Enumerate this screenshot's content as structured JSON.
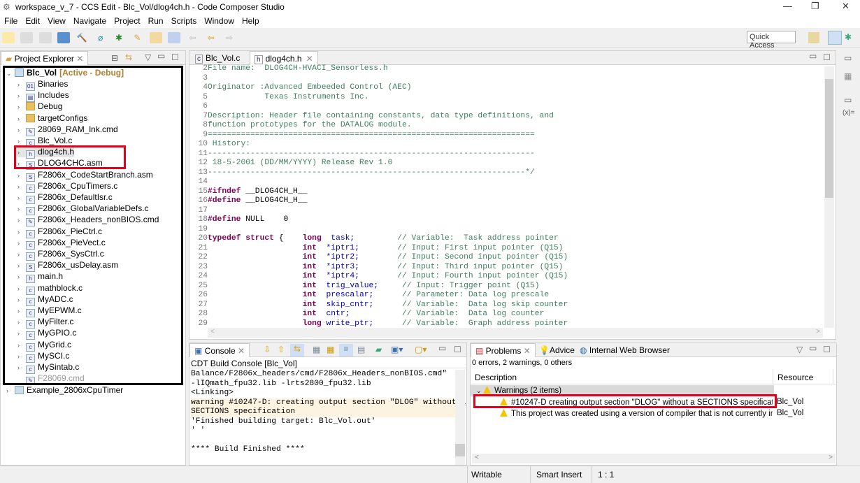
{
  "window": {
    "title": "workspace_v_7 - CCS Edit - Blc_Vol/dlog4ch.h - Code Composer Studio",
    "min": "—",
    "max": "❐",
    "close": "✕"
  },
  "menu": [
    "File",
    "Edit",
    "View",
    "Navigate",
    "Project",
    "Run",
    "Scripts",
    "Window",
    "Help"
  ],
  "toolbar": {
    "quick_access": "Quick Access"
  },
  "explorer": {
    "tab": "Project Explorer",
    "project": "Blc_Vol",
    "project_state": "[Active - Debug]",
    "items": [
      {
        "label": "Binaries",
        "icon": "binaries-icon"
      },
      {
        "label": "Includes",
        "icon": "includes-icon"
      },
      {
        "label": "Debug",
        "icon": "folder-icon"
      },
      {
        "label": "targetConfigs",
        "icon": "folder-icon"
      },
      {
        "label": "28069_RAM_lnk.cmd",
        "icon": "cmd-file-icon"
      },
      {
        "label": "Blc_Vol.c",
        "icon": "c-file-icon"
      },
      {
        "label": "dlog4ch.h",
        "icon": "h-file-icon"
      },
      {
        "label": "DLOG4CHC.asm",
        "icon": "asm-file-icon"
      },
      {
        "label": "F2806x_CodeStartBranch.asm",
        "icon": "asm-file-icon"
      },
      {
        "label": "F2806x_CpuTimers.c",
        "icon": "c-file-icon"
      },
      {
        "label": "F2806x_DefaultIsr.c",
        "icon": "c-file-icon"
      },
      {
        "label": "F2806x_GlobalVariableDefs.c",
        "icon": "c-file-icon"
      },
      {
        "label": "F2806x_Headers_nonBIOS.cmd",
        "icon": "cmd-file-icon"
      },
      {
        "label": "F2806x_PieCtrl.c",
        "icon": "c-file-icon"
      },
      {
        "label": "F2806x_PieVect.c",
        "icon": "c-file-icon"
      },
      {
        "label": "F2806x_SysCtrl.c",
        "icon": "c-file-icon"
      },
      {
        "label": "F2806x_usDelay.asm",
        "icon": "asm-file-icon"
      },
      {
        "label": "main.h",
        "icon": "h-file-icon"
      },
      {
        "label": "mathblock.c",
        "icon": "c-file-icon"
      },
      {
        "label": "MyADC.c",
        "icon": "c-file-icon"
      },
      {
        "label": "MyEPWM.c",
        "icon": "c-file-icon"
      },
      {
        "label": "MyFilter.c",
        "icon": "c-file-icon"
      },
      {
        "label": "MyGPIO.c",
        "icon": "c-file-icon"
      },
      {
        "label": "MyGrid.c",
        "icon": "c-file-icon"
      },
      {
        "label": "MySCI.c",
        "icon": "c-file-icon"
      },
      {
        "label": "MySintab.c",
        "icon": "c-file-icon"
      },
      {
        "label": "F28069.cmd",
        "icon": "cmd-file-icon"
      }
    ],
    "other_project": "Example_2806xCpuTimer"
  },
  "editor": {
    "tabs": [
      {
        "label": "Blc_Vol.c",
        "active": false
      },
      {
        "label": "dlog4ch.h",
        "active": true
      }
    ],
    "lines": [
      {
        "n": "2",
        "segs": [
          [
            "cm",
            "File name:  DLOG4CH-HVACI_Sensorless.h"
          ]
        ]
      },
      {
        "n": "3",
        "segs": []
      },
      {
        "n": "4",
        "segs": [
          [
            "cm",
            "Originator :Advanced Embeeded Control (AEC)"
          ]
        ]
      },
      {
        "n": "5",
        "segs": [
          [
            "cm",
            "            Texas Instruments Inc."
          ]
        ]
      },
      {
        "n": "6",
        "segs": []
      },
      {
        "n": "7",
        "segs": [
          [
            "cm",
            "Description: Header file containing constants, data type definitions, and"
          ]
        ]
      },
      {
        "n": "8",
        "segs": [
          [
            "cm",
            "function prototypes for the DATALOG module."
          ]
        ]
      },
      {
        "n": "9",
        "segs": [
          [
            "cm",
            "====================================================================="
          ]
        ]
      },
      {
        "n": "10",
        "segs": [
          [
            "cm",
            " History:"
          ]
        ]
      },
      {
        "n": "11",
        "segs": [
          [
            "cm",
            "---------------------------------------------------------------------"
          ]
        ]
      },
      {
        "n": "12",
        "segs": [
          [
            "cm",
            " 18-5-2001 (DD/MM/YYYY) Release Rev 1.0"
          ]
        ]
      },
      {
        "n": "13",
        "segs": [
          [
            "cm",
            "-------------------------------------------------------------------*/"
          ]
        ]
      },
      {
        "n": "14",
        "segs": []
      },
      {
        "n": "15",
        "segs": [
          [
            "pp",
            "#ifndef"
          ],
          [
            "id",
            " __DLOG4CH_H__"
          ]
        ]
      },
      {
        "n": "16",
        "segs": [
          [
            "pp",
            "#define"
          ],
          [
            "id",
            " __DLOG4CH_H__"
          ]
        ]
      },
      {
        "n": "17",
        "segs": []
      },
      {
        "n": "18",
        "segs": [
          [
            "pp",
            "#define"
          ],
          [
            "id",
            " NULL    0"
          ]
        ]
      },
      {
        "n": "19",
        "segs": []
      },
      {
        "n": "20",
        "segs": [
          [
            "kw",
            "typedef struct"
          ],
          [
            "id",
            " {    "
          ],
          [
            "kw",
            "long"
          ],
          [
            "fld",
            "  task;"
          ],
          [
            "cm",
            "         // Variable:  Task address pointer"
          ]
        ]
      },
      {
        "n": "21",
        "segs": [
          [
            "id",
            "                    "
          ],
          [
            "kw",
            "int"
          ],
          [
            "fld",
            "  *iptr1;"
          ],
          [
            "cm",
            "        // Input: First input pointer (Q15)"
          ]
        ]
      },
      {
        "n": "22",
        "segs": [
          [
            "id",
            "                    "
          ],
          [
            "kw",
            "int"
          ],
          [
            "fld",
            "  *iptr2;"
          ],
          [
            "cm",
            "        // Input: Second input pointer (Q15)"
          ]
        ]
      },
      {
        "n": "23",
        "segs": [
          [
            "id",
            "                    "
          ],
          [
            "kw",
            "int"
          ],
          [
            "fld",
            "  *iptr3;"
          ],
          [
            "cm",
            "        // Input: Third input pointer (Q15)"
          ]
        ]
      },
      {
        "n": "24",
        "segs": [
          [
            "id",
            "                    "
          ],
          [
            "kw",
            "int"
          ],
          [
            "fld",
            "  *iptr4;"
          ],
          [
            "cm",
            "        // Input: Fourth input pointer (Q15)"
          ]
        ]
      },
      {
        "n": "25",
        "segs": [
          [
            "id",
            "                    "
          ],
          [
            "kw",
            "int"
          ],
          [
            "fld",
            "  trig_value;"
          ],
          [
            "cm",
            "     // Input: Trigger point (Q15)"
          ]
        ]
      },
      {
        "n": "26",
        "segs": [
          [
            "id",
            "                    "
          ],
          [
            "kw",
            "int"
          ],
          [
            "fld",
            "  prescalar;"
          ],
          [
            "cm",
            "      // Parameter: Data log prescale"
          ]
        ]
      },
      {
        "n": "27",
        "segs": [
          [
            "id",
            "                    "
          ],
          [
            "kw",
            "int"
          ],
          [
            "fld",
            "  skip_cntr;"
          ],
          [
            "cm",
            "      // Variable:  Data log skip counter"
          ]
        ]
      },
      {
        "n": "28",
        "segs": [
          [
            "id",
            "                    "
          ],
          [
            "kw",
            "int"
          ],
          [
            "fld",
            "  cntr;"
          ],
          [
            "cm",
            "           // Variable:  Data log counter"
          ]
        ]
      },
      {
        "n": "29",
        "segs": [
          [
            "id",
            "                    "
          ],
          [
            "kw",
            "long"
          ],
          [
            "fld",
            " write_ptr;"
          ],
          [
            "cm",
            "      // Variable:  Graph address pointer"
          ]
        ]
      }
    ]
  },
  "console": {
    "tab": "Console",
    "title": "CDT Build Console [Blc_Vol]",
    "lines": [
      {
        "text": "Balance/F2806x_headers/cmd/F2806x_Headers_nonBIOS.cmd\"",
        "warn": false
      },
      {
        "text": "-lIQmath_fpu32.lib -lrts2800_fpu32.lib",
        "warn": false
      },
      {
        "text": "<Linking>",
        "warn": false
      },
      {
        "text": "warning #10247-D: creating output section \"DLOG\" without a",
        "warn": true
      },
      {
        "text": "SECTIONS specification",
        "warn": true
      },
      {
        "text": "'Finished building target: Blc_Vol.out'",
        "warn": false
      },
      {
        "text": "' '",
        "warn": false
      },
      {
        "text": "",
        "warn": false
      },
      {
        "text": "**** Build Finished ****",
        "warn": false
      }
    ]
  },
  "problems": {
    "tabs": [
      "Problems",
      "Advice",
      "Internal Web Browser"
    ],
    "summary": "0 errors, 2 warnings, 0 others",
    "columns": [
      "Description",
      "Resource"
    ],
    "group": "Warnings (2 items)",
    "rows": [
      {
        "description": "#10247-D creating output section \"DLOG\" without a SECTIONS specification",
        "resource": "Blc_Vol"
      },
      {
        "description": "This project was created using a version of compiler that is not currently installe",
        "resource": "Blc_Vol"
      }
    ]
  },
  "status": {
    "writable": "Writable",
    "insert": "Smart Insert",
    "position": "1 : 1"
  },
  "colors": {
    "highlight": "#e3001b",
    "warning_bg": "#fdf3e1"
  }
}
